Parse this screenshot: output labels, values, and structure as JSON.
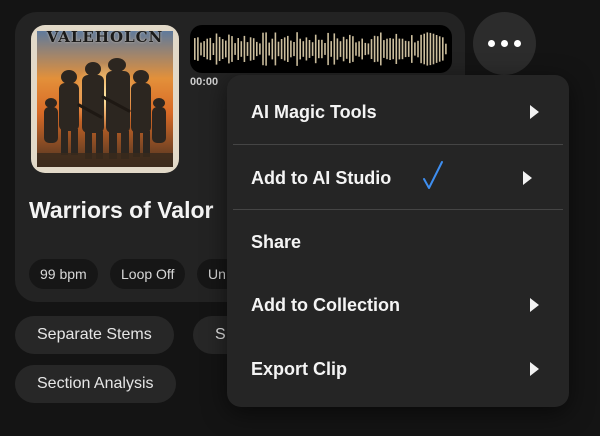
{
  "track": {
    "cover_text": "VALEHOLCN",
    "current_time": "00:00",
    "title": "Warriors of Valor",
    "chips": [
      "99 bpm",
      "Loop Off",
      "Un"
    ]
  },
  "actions": {
    "separate_stems": "Separate Stems",
    "second_action_partial": "S",
    "section_analysis": "Section Analysis"
  },
  "menu": {
    "items": [
      {
        "label": "AI Magic Tools",
        "has_submenu": true
      },
      {
        "label": "Add to AI Studio",
        "has_submenu": true,
        "badge_icon": "checkmark-icon"
      },
      {
        "label": "Share",
        "has_submenu": false
      },
      {
        "label": "Add to Collection",
        "has_submenu": true
      },
      {
        "label": "Export Clip",
        "has_submenu": true
      }
    ]
  },
  "colors": {
    "background": "#141414",
    "card": "#232323",
    "menu": "#252525",
    "waveform": "#cdbf9e",
    "checkmark": "#3e8ef0"
  }
}
